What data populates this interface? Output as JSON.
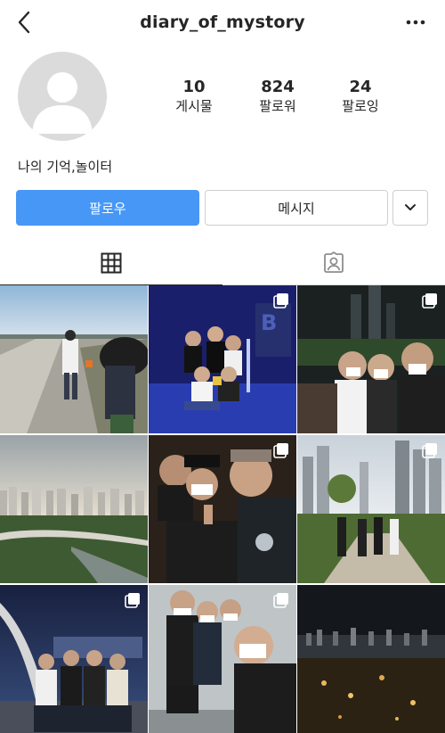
{
  "header": {
    "username": "diary_of_mystory"
  },
  "stats": [
    {
      "value": "10",
      "label": "게시물"
    },
    {
      "value": "824",
      "label": "팔로워"
    },
    {
      "value": "24",
      "label": "팔로잉"
    }
  ],
  "bio": "나의 기억,놀이터",
  "buttons": {
    "follow": "팔로우",
    "message": "메시지"
  },
  "tabs": {
    "active": "grid"
  },
  "posts": [
    {
      "scene": "outdoor walkway by the sea",
      "multiple": false
    },
    {
      "scene": "group photo in blue lit studio",
      "multiple": true
    },
    {
      "scene": "night selfie of friends",
      "multiple": true
    },
    {
      "scene": "city skyline at dusk",
      "multiple": false
    },
    {
      "scene": "night selfie group",
      "multiple": true
    },
    {
      "scene": "friends walking in park",
      "multiple": true
    },
    {
      "scene": "friends at night viewpoint",
      "multiple": true
    },
    {
      "scene": "selfie group outdoors",
      "multiple": true
    },
    {
      "scene": "city night view",
      "multiple": false
    }
  ],
  "colors": {
    "accent": "#4797f7",
    "text": "#262626",
    "border": "#dbdbdb"
  }
}
